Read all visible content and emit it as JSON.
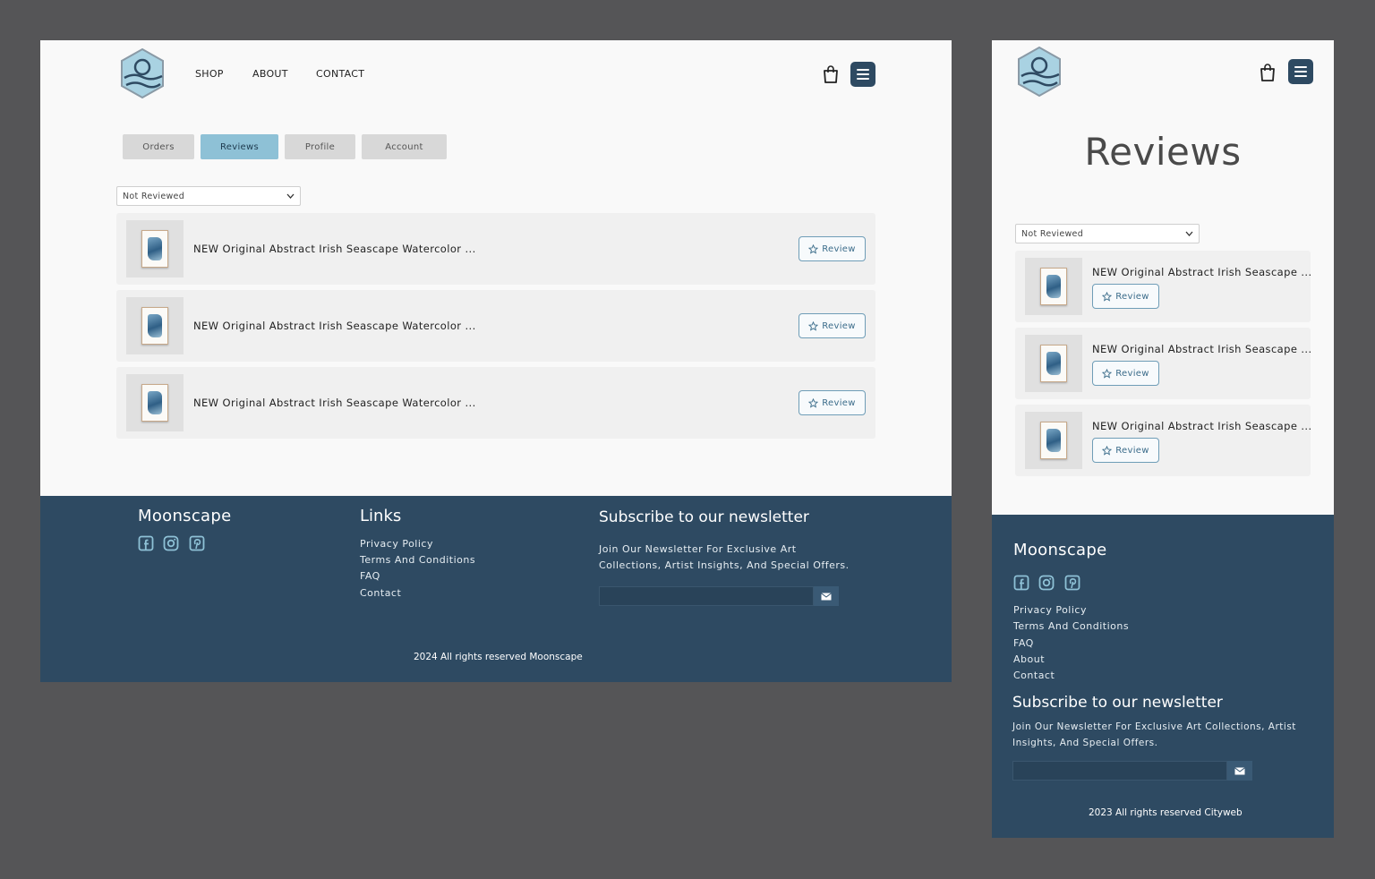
{
  "desktop": {
    "nav": [
      "SHOP",
      "ABOUT",
      "CONTACT"
    ],
    "tabs": [
      "Orders",
      "Reviews",
      "Profile",
      "Account"
    ],
    "active_tab": "Reviews",
    "filter": "Not Reviewed",
    "items": [
      {
        "title": "NEW Original Abstract Irish Seascape Watercolor ...",
        "button": "Review"
      },
      {
        "title": "NEW Original Abstract Irish Seascape Watercolor ...",
        "button": "Review"
      },
      {
        "title": "NEW Original Abstract Irish Seascape Watercolor ...",
        "button": "Review"
      }
    ],
    "footer": {
      "brand": "Moonscape",
      "links_heading": "Links",
      "links": [
        "Privacy Policy",
        "Terms And Conditions",
        "FAQ",
        "Contact"
      ],
      "newsletter_heading": "Subscribe to our newsletter",
      "newsletter_line1": "Join Our Newsletter For Exclusive Art",
      "newsletter_line2": "Collections, Artist Insights, And Special Offers.",
      "copyright": "2024 All rights reserved Moonscape"
    }
  },
  "mobile": {
    "page_title": "Reviews",
    "filter": "Not Reviewed",
    "items": [
      {
        "title": "NEW Original Abstract Irish Seascape ...",
        "button": "Review"
      },
      {
        "title": "NEW Original Abstract Irish Seascape ...",
        "button": "Review"
      },
      {
        "title": "NEW Original Abstract Irish Seascape ...",
        "button": "Review"
      }
    ],
    "footer": {
      "brand": "Moonscape",
      "links": [
        "Privacy Policy",
        "Terms And Conditions",
        "FAQ",
        "About",
        "Contact"
      ],
      "newsletter_heading": "Subscribe to our newsletter",
      "newsletter_line1": "Join Our Newsletter For Exclusive Art Collections, Artist",
      "newsletter_line2": "Insights, And Special Offers.",
      "copyright": "2023 All rights reserved Cityweb"
    }
  },
  "icons": [
    "moonscape-logo",
    "shopping-bag-icon",
    "menu-icon",
    "chevron-down-icon",
    "star-icon",
    "facebook-icon",
    "instagram-icon",
    "pinterest-icon",
    "envelope-icon"
  ],
  "colors": {
    "primary": "#2e4a62",
    "active_tab": "#8ec1d6",
    "review_border": "#6f9db7"
  }
}
